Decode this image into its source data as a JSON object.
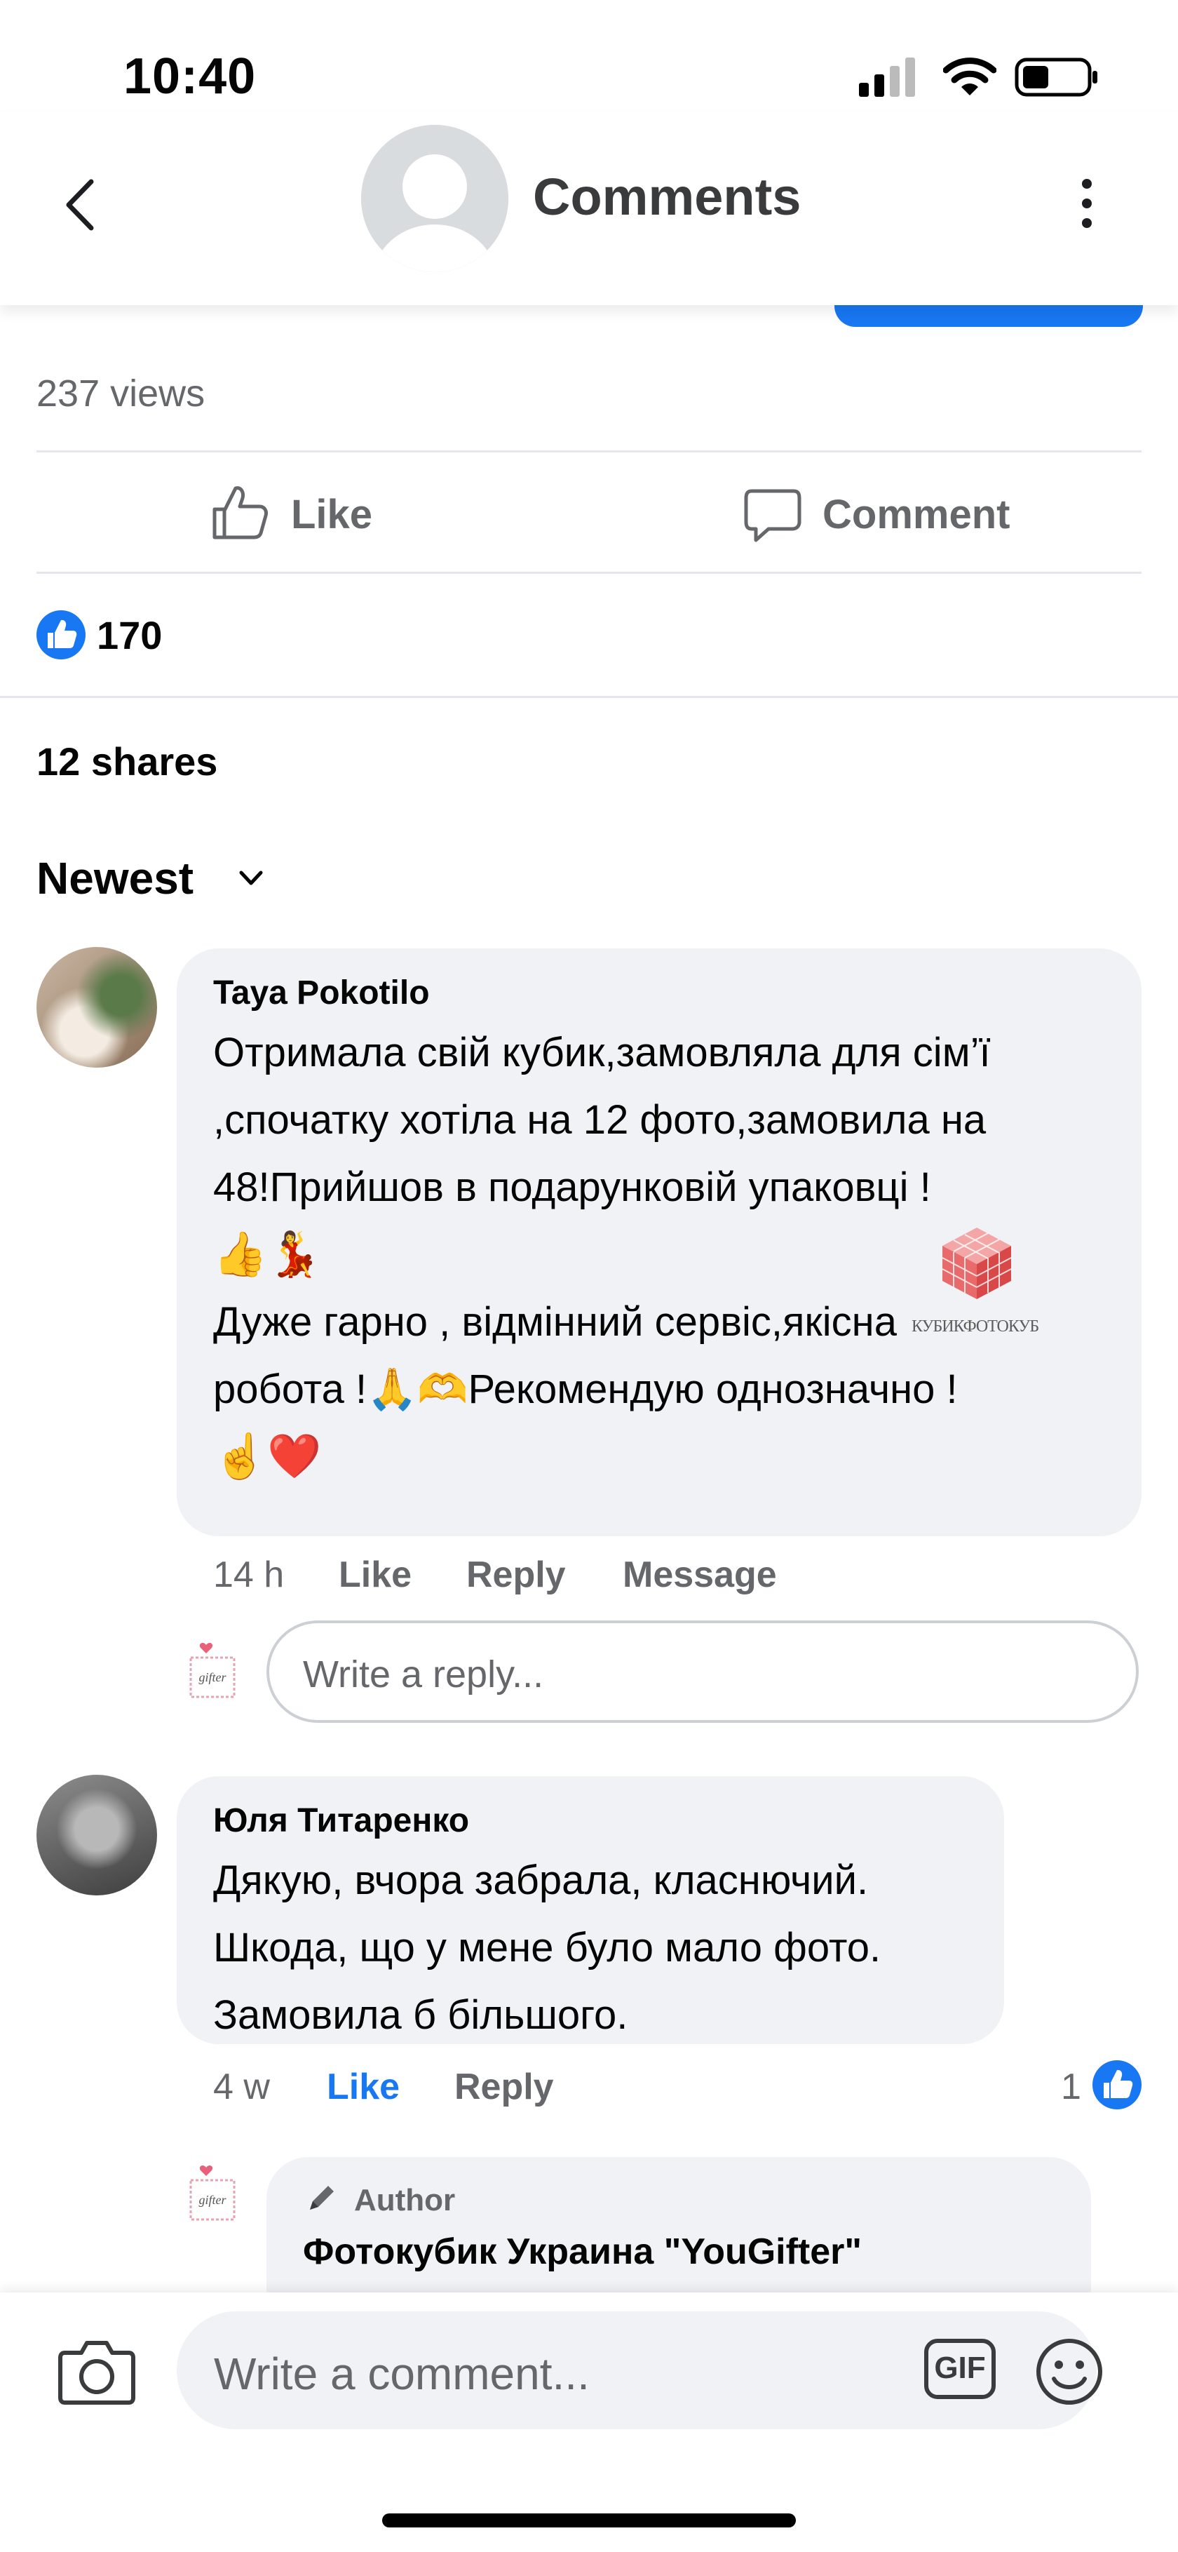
{
  "status_bar": {
    "time": "10:40"
  },
  "header": {
    "title": "Comments"
  },
  "post": {
    "views": "237 views",
    "like_label": "Like",
    "comment_label": "Comment",
    "reaction_count": "170",
    "shares": "12 shares",
    "sort_label": "Newest"
  },
  "comments": [
    {
      "author": "Taya Pokotilo",
      "line1": "Отримала свій кубик,замовляла для сім’ї",
      "line2": ",спочатку хотіла на 12 фото,замовила на",
      "line3": "48!Прийшов в подарунковій упаковці !",
      "emoji1": "👍💃",
      "line4": "Дуже гарно , відмінний сервіс,якісна",
      "line5": "робота !🙏🫶Рекомендую однозначно !",
      "emoji2": "☝️❤️",
      "time": "14 h",
      "like": "Like",
      "reply": "Reply",
      "message": "Message"
    },
    {
      "author": "Юля Титаренко",
      "line1": "Дякую, вчора забрала, класнючий.",
      "line2": "Шкода, що у мене було мало фото.",
      "line3": "Замовила б більшого.",
      "time": "4 w",
      "like": "Like",
      "reply": "Reply",
      "reaction_count": "1"
    },
    {
      "badge": "Author",
      "author": "Фотокубик Украина \"YouGifter\""
    }
  ],
  "reply_box": {
    "placeholder": "Write a reply..."
  },
  "composer": {
    "placeholder": "Write a comment...",
    "gif_label": "GIF"
  },
  "watermark": {
    "text": "КУБИКФОТОКУБ"
  },
  "colors": {
    "accent": "#1877f2",
    "bubble": "#f0f2f5",
    "muted": "#65676b"
  }
}
